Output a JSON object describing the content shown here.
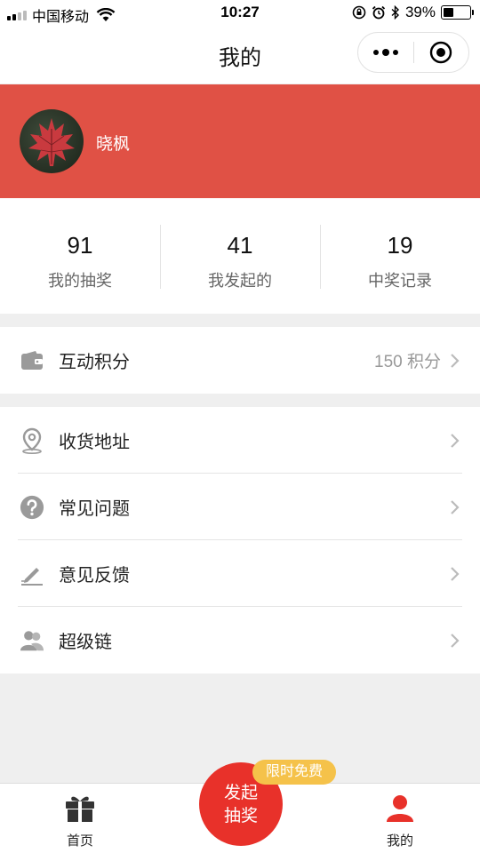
{
  "status_bar": {
    "carrier": "中国移动",
    "time": "10:27",
    "battery": "39%",
    "battery_level": 0.39,
    "icons": [
      "signal-icon",
      "wifi-icon",
      "rotation-lock-icon",
      "alarm-icon",
      "bluetooth-icon",
      "battery-icon"
    ]
  },
  "nav": {
    "title": "我的",
    "icons": [
      "more-icon",
      "close-target-icon"
    ]
  },
  "profile": {
    "username": "晓枫",
    "banner_color": "#e05145"
  },
  "stats": [
    {
      "value": "91",
      "label": "我的抽奖"
    },
    {
      "value": "41",
      "label": "我发起的"
    },
    {
      "value": "19",
      "label": "中奖记录"
    }
  ],
  "points_row": {
    "label": "互动积分",
    "value": "150 积分",
    "icon": "wallet-icon"
  },
  "menu": [
    {
      "label": "收货地址",
      "icon": "location-pin-icon"
    },
    {
      "label": "常见问题",
      "icon": "question-icon"
    },
    {
      "label": "意见反馈",
      "icon": "edit-icon"
    },
    {
      "label": "超级链",
      "icon": "users-icon"
    }
  ],
  "tab_bar": {
    "home_label": "首页",
    "launch_label": "发起抽奖",
    "launch_line1": "发起",
    "launch_line2": "抽奖",
    "badge": "限时免费",
    "mine_label": "我的",
    "accent": "#e8312a",
    "badge_color": "#f5c24a"
  }
}
